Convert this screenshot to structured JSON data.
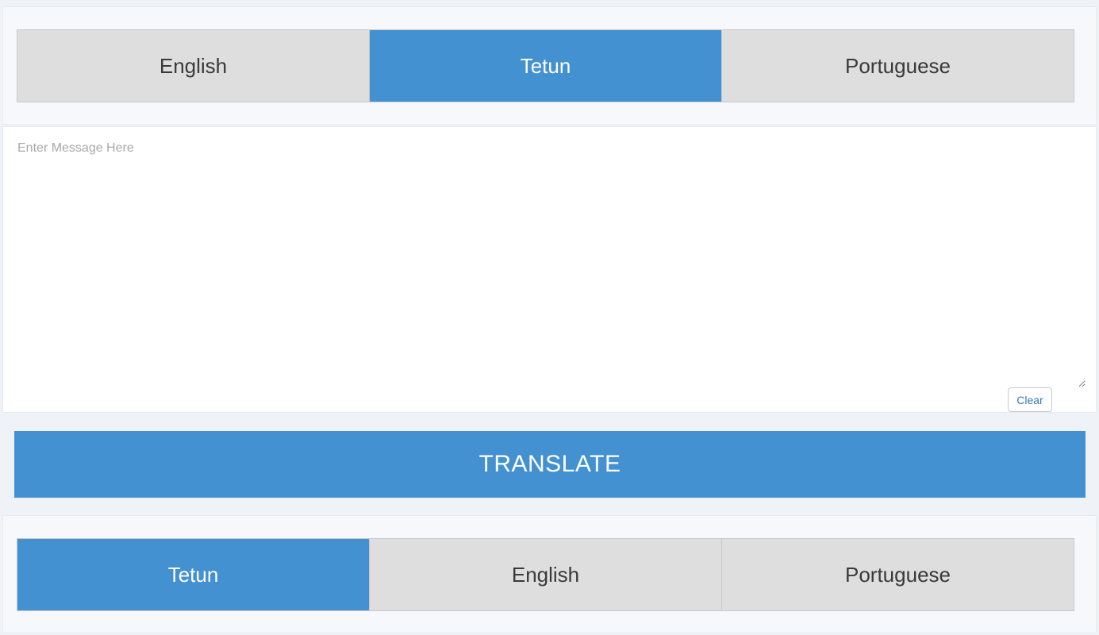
{
  "source_languages": {
    "tabs": [
      {
        "label": "English",
        "active": false
      },
      {
        "label": "Tetun",
        "active": true
      },
      {
        "label": "Portuguese",
        "active": false
      }
    ]
  },
  "message": {
    "placeholder": "Enter Message Here",
    "value": "",
    "clear_label": "Clear"
  },
  "translate": {
    "label": "TRANSLATE"
  },
  "target_languages": {
    "tabs": [
      {
        "label": "Tetun",
        "active": true
      },
      {
        "label": "English",
        "active": false
      },
      {
        "label": "Portuguese",
        "active": false
      }
    ]
  },
  "colors": {
    "accent": "#4391d0",
    "inactive_tab": "#dedede",
    "page_background": "#eff3f8"
  }
}
